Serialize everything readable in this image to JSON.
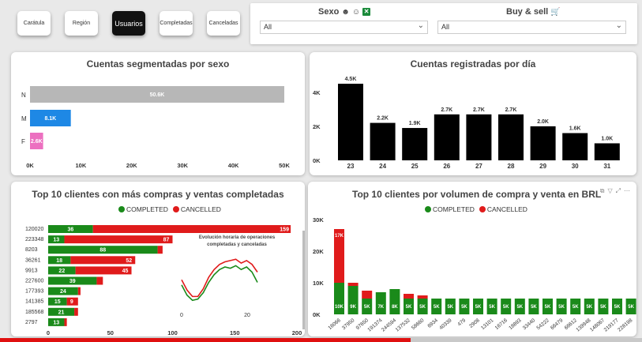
{
  "nav": {
    "buttons": [
      {
        "label": "Carátula",
        "active": false
      },
      {
        "label": "Región",
        "active": false
      },
      {
        "label": "Usuarios",
        "active": true
      },
      {
        "label": "Completadas",
        "active": false
      },
      {
        "label": "Canceladas",
        "active": false
      }
    ]
  },
  "filters": {
    "sexo_title": "Sexo",
    "sexo_value": "All",
    "buy_title": "Buy & sell",
    "buy_value": "All"
  },
  "colors": {
    "completed": "#1a8a1a",
    "cancelled": "#e01b1b",
    "gray": "#b7b7b7",
    "blue": "#1e88e5",
    "pink": "#ec70c0",
    "black": "#000000"
  },
  "chart_data": [
    {
      "type": "bar",
      "orientation": "horizontal",
      "title": "Cuentas segmentadas por sexo",
      "categories": [
        "N",
        "M",
        "F"
      ],
      "values": [
        50600,
        8100,
        2600
      ],
      "labels": [
        "50.6K",
        "8.1K",
        "2.6K"
      ],
      "colors": [
        "#b7b7b7",
        "#1e88e5",
        "#ec70c0"
      ],
      "xlim": [
        0,
        50000
      ],
      "xticks": [
        "0K",
        "10K",
        "20K",
        "30K",
        "40K",
        "50K"
      ]
    },
    {
      "type": "bar",
      "title": "Cuentas registradas por día",
      "categories": [
        "23",
        "24",
        "25",
        "26",
        "27",
        "28",
        "29",
        "30",
        "31"
      ],
      "values": [
        4500,
        2200,
        1900,
        2700,
        2700,
        2700,
        2000,
        1600,
        1000
      ],
      "labels": [
        "4.5K",
        "2.2K",
        "1.9K",
        "2.7K",
        "2.7K",
        "2.7K",
        "2.0K",
        "1.6K",
        "1.0K"
      ],
      "ylim": [
        0,
        4500
      ],
      "yticks": [
        "0K",
        "2K",
        "4K"
      ]
    },
    {
      "type": "bar",
      "orientation": "horizontal",
      "stacked": true,
      "title": "Top 10 clientes con más compras y ventas completadas",
      "legend": [
        "COMPLETED",
        "CANCELLED"
      ],
      "categories": [
        "120020",
        "223348",
        "8203",
        "36261",
        "9913",
        "227600",
        "177393",
        "141385",
        "185568",
        "2797"
      ],
      "series": [
        {
          "name": "COMPLETED",
          "values": [
            36,
            13,
            88,
            18,
            22,
            39,
            24,
            15,
            21,
            13
          ]
        },
        {
          "name": "CANCELLED",
          "values": [
            159,
            87,
            4,
            52,
            45,
            5,
            2,
            9,
            3,
            2
          ]
        }
      ],
      "xlim": [
        0,
        200
      ],
      "xticks": [
        "0",
        "50",
        "100",
        "150",
        "200"
      ]
    },
    {
      "type": "line",
      "title": "Evolución horaria de operaciones completadas y canceladas",
      "xticks": [
        "0",
        "20"
      ],
      "series": [
        {
          "name": "COMPLETED",
          "values": [
            18,
            10,
            6,
            7,
            12,
            20,
            26,
            30,
            32,
            31,
            33,
            30,
            32,
            28,
            20
          ]
        },
        {
          "name": "CANCELLED",
          "values": [
            22,
            14,
            9,
            9,
            15,
            24,
            30,
            34,
            36,
            37,
            38,
            35,
            37,
            34,
            28
          ]
        }
      ]
    },
    {
      "type": "bar",
      "stacked": true,
      "title": "Top 10 clientes por volumen de compra y venta en BRL",
      "legend": [
        "COMPLETED",
        "CANCELLED"
      ],
      "categories": [
        "16066",
        "37950",
        "97650",
        "191374",
        "244594",
        "137532",
        "58660",
        "6934",
        "40339",
        "479",
        "2908",
        "13101",
        "16716",
        "18893",
        "33440",
        "54222",
        "66479",
        "66612",
        "139948",
        "148067",
        "219177",
        "228198"
      ],
      "series": [
        {
          "name": "COMPLETED",
          "values": [
            10000,
            9000,
            5000,
            7000,
            8000,
            5000,
            5000,
            5000,
            5000,
            5000,
            5000,
            5000,
            5000,
            5000,
            5000,
            5000,
            5000,
            5000,
            5000,
            5000,
            5000,
            5000
          ]
        },
        {
          "name": "CANCELLED",
          "values": [
            17000,
            1000,
            2500,
            0,
            0,
            1500,
            1000,
            0,
            0,
            0,
            0,
            0,
            0,
            0,
            0,
            0,
            0,
            0,
            0,
            0,
            0,
            0
          ]
        }
      ],
      "labels": [
        "10K",
        "9K",
        "5K",
        "7K",
        "8K",
        "5K",
        "5K",
        "5K",
        "5K",
        "5K",
        "5K",
        "5K",
        "5K",
        "5K",
        "5K",
        "5K",
        "5K",
        "5K",
        "5K",
        "5K",
        "5K",
        "5K"
      ],
      "top_label": "17K",
      "ylim": [
        0,
        30000
      ],
      "yticks": [
        "0K",
        "10K",
        "20K",
        "30K"
      ]
    }
  ]
}
